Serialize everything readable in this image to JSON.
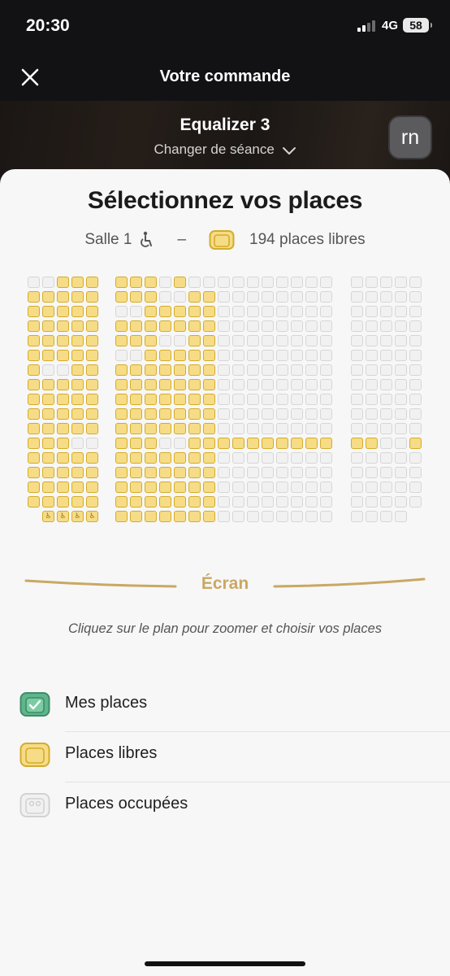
{
  "status": {
    "time": "20:30",
    "network": "4G",
    "battery": "58"
  },
  "nav": {
    "title": "Votre commande",
    "close_icon": "close-icon"
  },
  "movie": {
    "title": "Equalizer 3",
    "change_session": "Changer de séance",
    "avatar_initials": "rn"
  },
  "sheet": {
    "title": "Sélectionnez vos places",
    "room": "Salle 1",
    "separator": "–",
    "free_count": "194 places libres"
  },
  "screen": {
    "label": "Écran"
  },
  "hint": "Cliquez sur le plan pour zoomer et choisir vos places",
  "legend": [
    {
      "label": "Mes places",
      "icon": "my-seat-icon",
      "color": "#5fb58c"
    },
    {
      "label": "Places libres",
      "icon": "free-seat-icon",
      "color": "#f6dc86"
    },
    {
      "label": "Places occupées",
      "icon": "occupied-seat-icon",
      "color": "#e0e0e0"
    }
  ],
  "colors": {
    "free": "#f6dc86",
    "free_border": "#d3ac2c",
    "occupied": "#f1f1f1",
    "mine": "#5fb58c",
    "screen": "#c9a862"
  }
}
